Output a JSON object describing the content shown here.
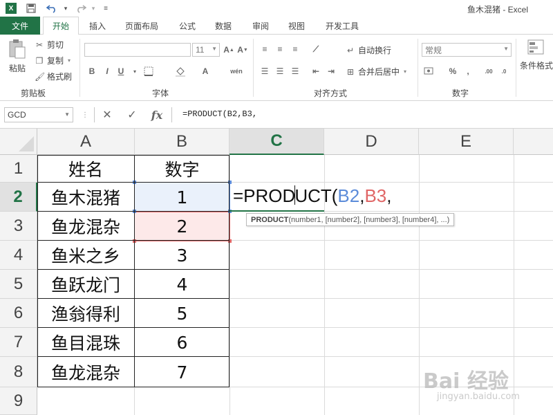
{
  "window": {
    "title": "鱼木混猪 - Excel"
  },
  "qat": {
    "logo": "X",
    "save_icon": "save-icon",
    "undo_icon": "undo-icon",
    "redo_icon": "redo-icon",
    "customize_icon": "customize-icon"
  },
  "tabs": {
    "file": "文件",
    "items": [
      "开始",
      "插入",
      "页面布局",
      "公式",
      "数据",
      "审阅",
      "视图",
      "开发工具"
    ],
    "active": "开始"
  },
  "ribbon": {
    "clipboard": {
      "paste": "粘贴",
      "cut": "剪切",
      "copy": "复制",
      "format_painter": "格式刷",
      "label": "剪贴板"
    },
    "font": {
      "font_name": "",
      "font_size": "11",
      "bold": "B",
      "italic": "I",
      "underline": "U",
      "label": "字体",
      "phonetic": "wén"
    },
    "alignment": {
      "wrap": "自动换行",
      "merge": "合并后居中",
      "label": "对齐方式"
    },
    "number": {
      "format": "常规",
      "percent": "%",
      "comma": ",",
      "label": "数字"
    },
    "styles": {
      "conditional": "条件格式"
    }
  },
  "formula_bar": {
    "name_box": "GCD",
    "formula": "=PRODUCT(B2,B3,"
  },
  "columns": [
    "A",
    "B",
    "C",
    "D",
    "E"
  ],
  "rows": [
    "1",
    "2",
    "3",
    "4",
    "5",
    "6",
    "7",
    "8",
    "9"
  ],
  "cells": {
    "A1": "姓名",
    "B1": "数字",
    "A2": "鱼木混猪",
    "B2": "1",
    "A3": "鱼龙混杂",
    "B3": "2",
    "A4": "鱼米之乡",
    "B4": "3",
    "A5": "鱼跃龙门",
    "B5": "4",
    "A6": "渔翁得利",
    "B6": "5",
    "A7": "鱼目混珠",
    "B7": "6",
    "A8": "鱼龙混杂",
    "B8": "7"
  },
  "editing": {
    "prefix": "=PROD",
    "mid": "UCT(",
    "ref1": "B2",
    "sep1": ",",
    "ref2": "B3",
    "sep2": ","
  },
  "tooltip": {
    "func": "PRODUCT",
    "args": "(number1, [number2], [number3], [number4], ...)"
  },
  "watermark": {
    "main": "Bai 经验",
    "sub": "jingyan.baidu.com"
  },
  "colors": {
    "accent": "#217346",
    "ref1": "#5b8bd9",
    "ref2": "#e06666"
  }
}
